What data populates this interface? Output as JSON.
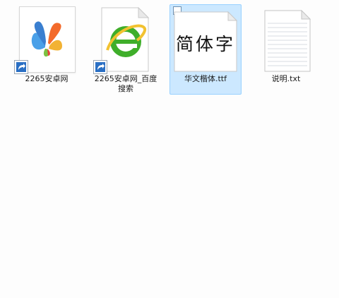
{
  "items": [
    {
      "label": "2265安卓网",
      "icon": "butterfly-shortcut-icon",
      "type": "shortcut"
    },
    {
      "label": "2265安卓网_百度搜索",
      "icon": "browser-shortcut-icon",
      "type": "shortcut"
    },
    {
      "label": "华文楷体.ttf",
      "icon": "font-file-icon",
      "type": "font",
      "preview_text": "简体字",
      "selected": true
    },
    {
      "label": "说明.txt",
      "icon": "text-document-icon",
      "type": "text"
    }
  ],
  "colors": {
    "selection_fill": "#cce8ff",
    "selection_border": "#99d1ff",
    "background": "#fdfdfd"
  }
}
